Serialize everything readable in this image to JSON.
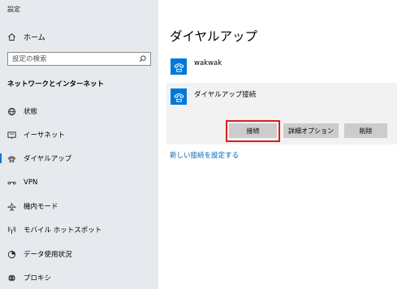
{
  "window": {
    "title": "設定"
  },
  "sidebar": {
    "home_label": "ホーム",
    "search_placeholder": "設定の検索",
    "section_title": "ネットワークとインターネット",
    "items": [
      {
        "label": "状態",
        "icon": "globe-icon"
      },
      {
        "label": "イーサネット",
        "icon": "ethernet-icon"
      },
      {
        "label": "ダイヤルアップ",
        "icon": "phone-icon",
        "active": true
      },
      {
        "label": "VPN",
        "icon": "vpn-icon"
      },
      {
        "label": "機内モード",
        "icon": "airplane-icon"
      },
      {
        "label": "モバイル ホットスポット",
        "icon": "hotspot-icon"
      },
      {
        "label": "データ使用状況",
        "icon": "data-usage-icon"
      },
      {
        "label": "プロキシ",
        "icon": "proxy-globe-icon"
      }
    ]
  },
  "main": {
    "title": "ダイヤルアップ",
    "connections": [
      {
        "name": "wakwak"
      },
      {
        "name": "ダイヤルアップ接続",
        "expanded": true
      }
    ],
    "buttons": {
      "connect": "接続",
      "advanced": "詳細オプション",
      "delete": "削除"
    },
    "link": "新しい接続を設定する"
  },
  "colors": {
    "sidebar_bg": "#e6e9ee",
    "accent": "#0078d7",
    "link": "#0063b1",
    "highlight_border": "#d81e1e",
    "button_bg": "#cccccc"
  }
}
